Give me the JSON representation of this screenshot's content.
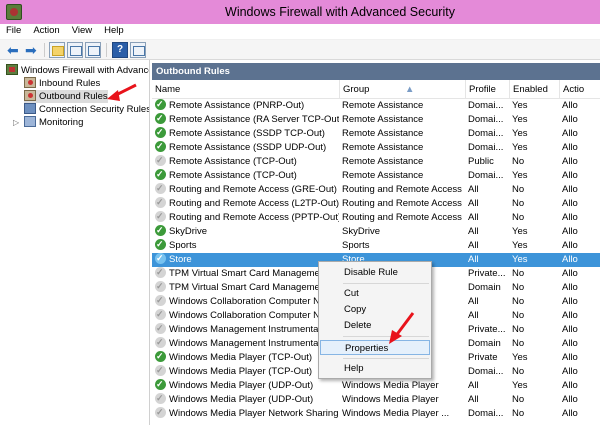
{
  "window": {
    "title": "Windows Firewall with Advanced Security"
  },
  "menu": [
    "File",
    "Action",
    "View",
    "Help"
  ],
  "toolbar": {
    "icons": [
      "back-icon",
      "forward-icon",
      "up-level-icon",
      "show-hide-tree-icon",
      "export-list-icon",
      "help-icon",
      "properties-icon"
    ]
  },
  "tree": {
    "root": "Windows Firewall with Advance",
    "items": [
      {
        "label": "Inbound Rules"
      },
      {
        "label": "Outbound Rules"
      },
      {
        "label": "Connection Security Rules"
      },
      {
        "label": "Monitoring"
      }
    ]
  },
  "section": {
    "title": "Outbound Rules"
  },
  "columns": {
    "name": "Name",
    "group": "Group",
    "profile": "Profile",
    "enabled": "Enabled",
    "action": "Actio"
  },
  "rows": [
    {
      "name": "Remote Assistance (PNRP-Out)",
      "group": "Remote Assistance",
      "profile": "Domai...",
      "enabled": "Yes",
      "action": "Allo",
      "on": true
    },
    {
      "name": "Remote Assistance (RA Server TCP-Out)",
      "group": "Remote Assistance",
      "profile": "Domai...",
      "enabled": "Yes",
      "action": "Allo",
      "on": true
    },
    {
      "name": "Remote Assistance (SSDP TCP-Out)",
      "group": "Remote Assistance",
      "profile": "Domai...",
      "enabled": "Yes",
      "action": "Allo",
      "on": true
    },
    {
      "name": "Remote Assistance (SSDP UDP-Out)",
      "group": "Remote Assistance",
      "profile": "Domai...",
      "enabled": "Yes",
      "action": "Allo",
      "on": true
    },
    {
      "name": "Remote Assistance (TCP-Out)",
      "group": "Remote Assistance",
      "profile": "Public",
      "enabled": "No",
      "action": "Allo",
      "on": false
    },
    {
      "name": "Remote Assistance (TCP-Out)",
      "group": "Remote Assistance",
      "profile": "Domai...",
      "enabled": "Yes",
      "action": "Allo",
      "on": true
    },
    {
      "name": "Routing and Remote Access (GRE-Out)",
      "group": "Routing and Remote Access",
      "profile": "All",
      "enabled": "No",
      "action": "Allo",
      "on": false
    },
    {
      "name": "Routing and Remote Access (L2TP-Out)",
      "group": "Routing and Remote Access",
      "profile": "All",
      "enabled": "No",
      "action": "Allo",
      "on": false
    },
    {
      "name": "Routing and Remote Access (PPTP-Out)",
      "group": "Routing and Remote Access",
      "profile": "All",
      "enabled": "No",
      "action": "Allo",
      "on": false
    },
    {
      "name": "SkyDrive",
      "group": "SkyDrive",
      "profile": "All",
      "enabled": "Yes",
      "action": "Allo",
      "on": true
    },
    {
      "name": "Sports",
      "group": "Sports",
      "profile": "All",
      "enabled": "Yes",
      "action": "Allo",
      "on": true
    },
    {
      "name": "Store",
      "group": "Store",
      "profile": "All",
      "enabled": "Yes",
      "action": "Allo",
      "on": true,
      "selected": true
    },
    {
      "name": "TPM Virtual Smart Card Management",
      "group": "",
      "profile": "Private...",
      "enabled": "No",
      "action": "Allo",
      "on": false
    },
    {
      "name": "TPM Virtual Smart Card Management",
      "group": "",
      "profile": "Domain",
      "enabled": "No",
      "action": "Allo",
      "on": false
    },
    {
      "name": "Windows Collaboration Computer Na",
      "group": "",
      "profile": "All",
      "enabled": "No",
      "action": "Allo",
      "on": false
    },
    {
      "name": "Windows Collaboration Computer Na",
      "group": "",
      "profile": "All",
      "enabled": "No",
      "action": "Allo",
      "on": false
    },
    {
      "name": "Windows Management Instrumentatio",
      "group": "",
      "profile": "Private...",
      "enabled": "No",
      "action": "Allo",
      "on": false
    },
    {
      "name": "Windows Management Instrumentatio",
      "group": "",
      "profile": "Domain",
      "enabled": "No",
      "action": "Allo",
      "on": false
    },
    {
      "name": "Windows Media Player (TCP-Out)",
      "group": "",
      "profile": "Private",
      "enabled": "Yes",
      "action": "Allo",
      "on": true
    },
    {
      "name": "Windows Media Player (TCP-Out)",
      "group": "",
      "profile": "Domai...",
      "enabled": "No",
      "action": "Allo",
      "on": false
    },
    {
      "name": "Windows Media Player (UDP-Out)",
      "group": "Windows Media Player",
      "profile": "All",
      "enabled": "Yes",
      "action": "Allo",
      "on": true
    },
    {
      "name": "Windows Media Player (UDP-Out)",
      "group": "Windows Media Player",
      "profile": "All",
      "enabled": "No",
      "action": "Allo",
      "on": false
    },
    {
      "name": "Windows Media Player Network Sharing ...",
      "group": "Windows Media Player ...",
      "profile": "Domai...",
      "enabled": "No",
      "action": "Allo",
      "on": false
    }
  ],
  "context_menu": {
    "items": [
      "Disable Rule",
      "Cut",
      "Copy",
      "Delete",
      "Properties",
      "Help"
    ],
    "highlighted": "Properties"
  },
  "colors": {
    "titlebar": "#e48ad8",
    "section_header": "#5c7290",
    "selection": "#3d94d9",
    "arrow": "#e8131b"
  }
}
